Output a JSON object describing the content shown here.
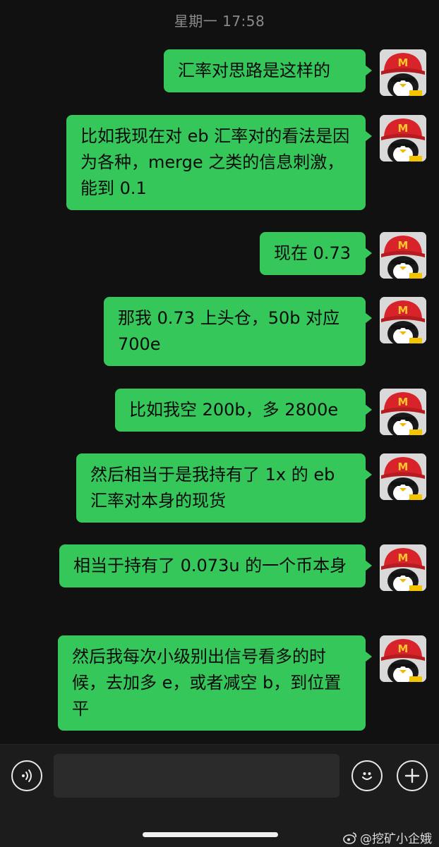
{
  "header": {
    "timestamp": "星期一 17:58"
  },
  "messages": [
    {
      "text": "汇率对思路是这样的"
    },
    {
      "text": "比如我现在对 eb 汇率对的看法是因为各种，merge 之类的信息刺激，能到 0.1"
    },
    {
      "text": "现在 0.73"
    },
    {
      "text": "那我 0.73 上头仓，50b 对应 700e"
    },
    {
      "text": "比如我空 200b，多 2800e"
    },
    {
      "text": "然后相当于是我持有了 1x 的 eb 汇率对本身的现货"
    },
    {
      "text": "相当于持有了 0.073u 的一个币本身"
    },
    {
      "text": "然后我每次小级别出信号看多的时候，去加多 e，或者减空 b，到位置平"
    }
  ],
  "watermark": {
    "text": "@挖矿小企娥"
  },
  "colors": {
    "bubble": "#35c75a",
    "background": "#111111",
    "footer": "#1c1c1c"
  },
  "icons": {
    "voice": "voice-icon",
    "emoji": "emoji-icon",
    "plus": "plus-icon",
    "weibo": "weibo-icon"
  }
}
